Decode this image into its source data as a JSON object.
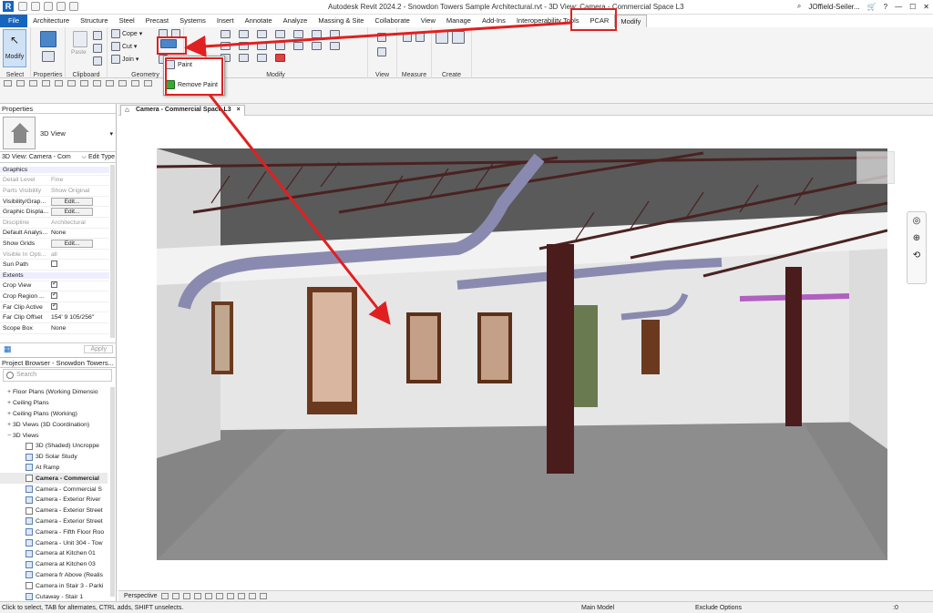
{
  "app": {
    "logo": "R",
    "title": "Autodesk Revit 2024.2 - Snowdon Towers Sample Architectural.rvt - 3D View: Camera - Commercial Space L3",
    "user": "JOffield-Seiler...",
    "help": "?"
  },
  "menu": [
    "File",
    "Architecture",
    "Structure",
    "Steel",
    "Precast",
    "Systems",
    "Insert",
    "Annotate",
    "Analyze",
    "Massing & Site",
    "Collaborate",
    "View",
    "Manage",
    "Add-Ins",
    "Interoperability Tools",
    "PCAR",
    "Modify"
  ],
  "ribbon": {
    "modify_label": "Modify",
    "select_label": "Select",
    "properties_label": "Properties",
    "clipboard_label": "Clipboard",
    "paste_label": "Paste",
    "cope_label": "Cope",
    "cut_label": "Cut",
    "join_label": "Join",
    "geometry_label": "Geometry",
    "modify_group_label": "Modify",
    "view_label": "View",
    "measure_label": "Measure",
    "create_label": "Create"
  },
  "paint_menu": {
    "paint": "Paint",
    "remove_paint": "Remove Paint"
  },
  "properties": {
    "header": "Properties",
    "type_name": "3D View",
    "instance": "3D View: Camera - Com",
    "edit_type": "Edit Type",
    "rows": [
      {
        "k": "Graphics",
        "v": "",
        "kind": "section"
      },
      {
        "k": "Detail Level",
        "v": "Fine",
        "kind": "grey"
      },
      {
        "k": "Parts Visibility",
        "v": "Show Original",
        "kind": "grey"
      },
      {
        "k": "Visibility/Grap...",
        "v": "Edit...",
        "kind": "btn"
      },
      {
        "k": "Graphic Displa...",
        "v": "Edit...",
        "kind": "btn"
      },
      {
        "k": "Discipline",
        "v": "Architectural",
        "kind": "grey"
      },
      {
        "k": "Default Analys...",
        "v": "None",
        "kind": "text"
      },
      {
        "k": "Show Grids",
        "v": "Edit...",
        "kind": "btn"
      },
      {
        "k": "Visible In Opti...",
        "v": "all",
        "kind": "grey"
      },
      {
        "k": "Sun Path",
        "v": "",
        "kind": "chk"
      },
      {
        "k": "Extents",
        "v": "",
        "kind": "section"
      },
      {
        "k": "Crop View",
        "v": "",
        "kind": "chkon"
      },
      {
        "k": "Crop Region ...",
        "v": "",
        "kind": "chkon"
      },
      {
        "k": "Far Clip Active",
        "v": "",
        "kind": "chkon"
      },
      {
        "k": "Far Clip Offset",
        "v": "154'  9 105/256\"",
        "kind": "text"
      },
      {
        "k": "Scope Box",
        "v": "None",
        "kind": "text"
      }
    ],
    "apply": "Apply"
  },
  "browser": {
    "header": "Project Browser - Snowdon Towers...",
    "search_placeholder": "Search",
    "items": [
      {
        "t": "+",
        "label": "Floor Plans (Working Dimensio",
        "lvl": 1
      },
      {
        "t": "+",
        "label": "Ceiling Plans",
        "lvl": 1
      },
      {
        "t": "+",
        "label": "Ceiling Plans (Working)",
        "lvl": 1
      },
      {
        "t": "+",
        "label": "3D Views (3D Coordination)",
        "lvl": 1
      },
      {
        "t": "−",
        "label": "3D Views",
        "lvl": 1
      },
      {
        "t": "",
        "label": "3D (Shaded) Uncroppe",
        "lvl": 2,
        "ico": "view"
      },
      {
        "t": "",
        "label": "3D Solar Study",
        "lvl": 2,
        "ico": "cam"
      },
      {
        "t": "",
        "label": "At Ramp",
        "lvl": 2,
        "ico": "cam"
      },
      {
        "t": "",
        "label": "Camera - Commercial",
        "lvl": 2,
        "ico": "view",
        "bold": true
      },
      {
        "t": "",
        "label": "Camera - Commercial S",
        "lvl": 2,
        "ico": "cam"
      },
      {
        "t": "",
        "label": "Camera - Exterior River",
        "lvl": 2,
        "ico": "cam"
      },
      {
        "t": "",
        "label": "Camera - Exterior Street",
        "lvl": 2,
        "ico": "view"
      },
      {
        "t": "",
        "label": "Camera - Exterior Street",
        "lvl": 2,
        "ico": "cam"
      },
      {
        "t": "",
        "label": "Camera - Fifth Floor Roo",
        "lvl": 2,
        "ico": "cam"
      },
      {
        "t": "",
        "label": "Camera - Unit 304 - Tow",
        "lvl": 2,
        "ico": "cam"
      },
      {
        "t": "",
        "label": "Camera at Kitchen 01",
        "lvl": 2,
        "ico": "cam"
      },
      {
        "t": "",
        "label": "Camera at Kitchen 03",
        "lvl": 2,
        "ico": "cam"
      },
      {
        "t": "",
        "label": "Camera fr Above (Realis",
        "lvl": 2,
        "ico": "cam"
      },
      {
        "t": "",
        "label": "Camera in Stair 3 - Parki",
        "lvl": 2,
        "ico": "view"
      },
      {
        "t": "",
        "label": "Cutaway - Stair 1",
        "lvl": 2,
        "ico": "cam"
      }
    ]
  },
  "view_tab": {
    "label": "Camera - Commercial Space L3",
    "close": "×"
  },
  "view_control": {
    "label": "Perspective"
  },
  "status": {
    "hint": "Click to select, TAB for alternates, CTRL adds, SHIFT unselects.",
    "model": "Main Model",
    "exclude": "Exclude Options",
    "filter": ":0"
  },
  "colors": {
    "accent": "#1565c0",
    "highlight": "#e02020"
  }
}
